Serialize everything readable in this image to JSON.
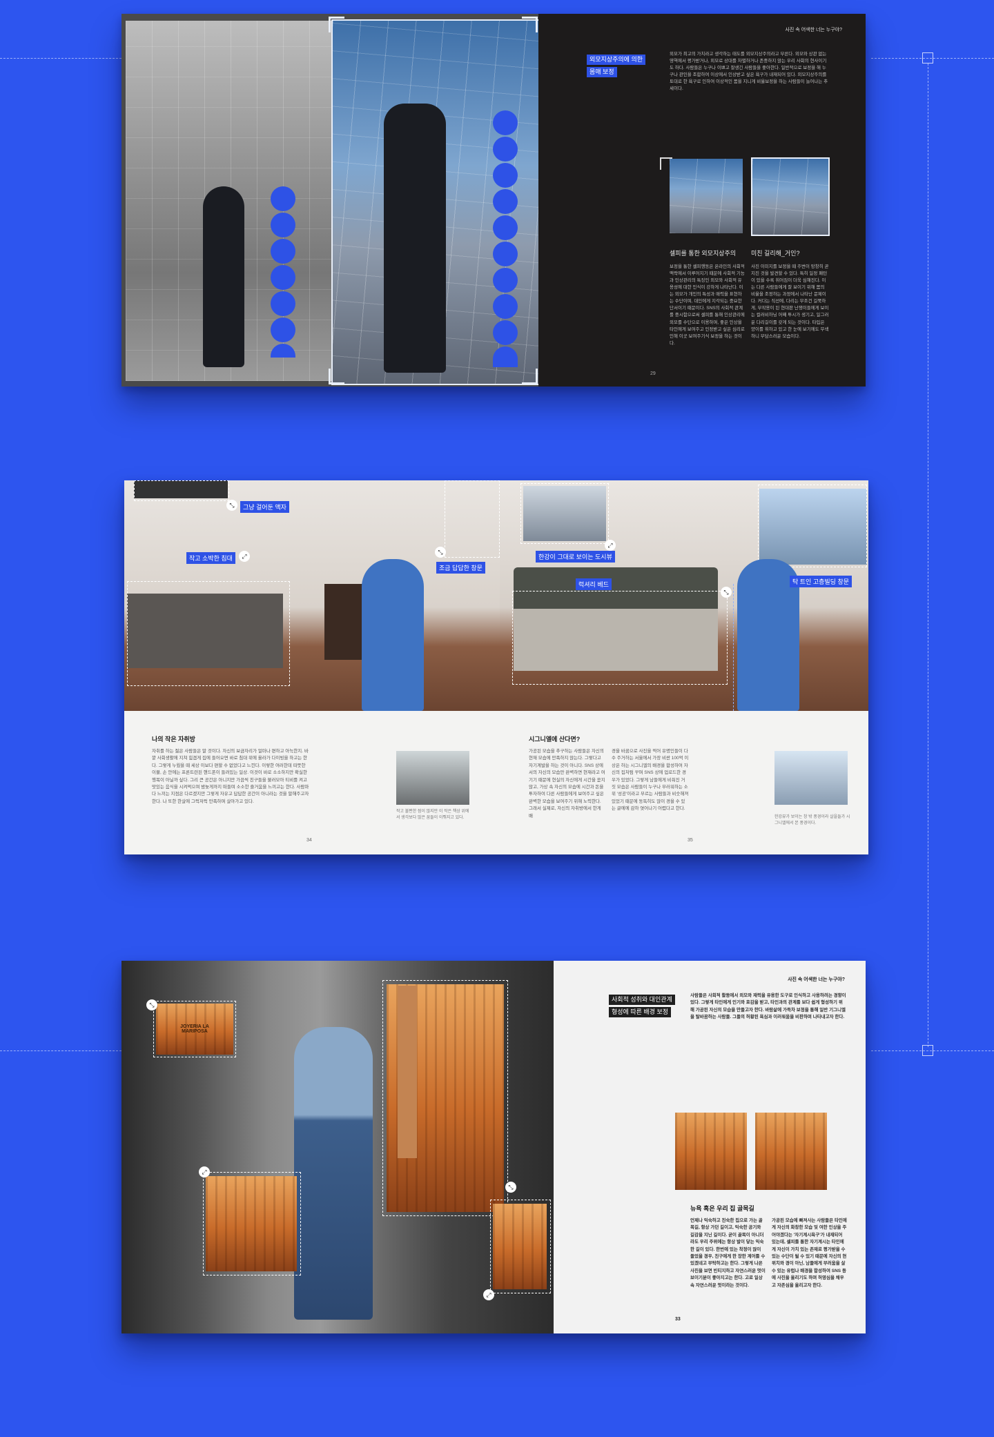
{
  "spread1": {
    "running_head": "사진 속 어색한 너는 누구야?",
    "tag": [
      "외모지상주의에 의한",
      "몸매 보정"
    ],
    "intro": "외모가 최고의 가치라고 생각하는 태도를 외모지상주의라고 부른다. 외모와 상관 없는 영역에서 평가받거나, 외모로 상대를 차별하거나 존중하지 않는 우리 사회의 현사이기도 하다. 사람들은 누구나 이쁘고 잘생긴 사람들을 좋아한다. 일반적으로 보정을 해 누구나 관인을 조합하여 이상에서 인상받고 싶은 욕구가 내재되어 있다. 외모지상주의를 토대로 한 욕구로 인하여 이상적인 몸을 지니게 비율보정을 하는 사람들이 늘어나는 추세이다.",
    "col1_head": "셀피를 통한 외모지상주의",
    "col1_body": "보정을 통한 셀피행동은 온라인의 사회적 맥락에서 이루어지기 때문에 사회적 기능과 인상관리의 특징인 외모와 사회적 유용성에 대한 인식이 강하게 나타난다. 이는 외모가 개인의 특성과 매력을 표현하는 수단이며, 대인에게 지각되는 중요한 단서이기 때문이다. SNS의 사회적 관계를 중시함으로써 셀피를 통해 인상관리에 외모를 수단으로 이용하며, 좋은 인상을 타인에게 보여주고 인정받고 싶은 심리로 인해 이곳 보여주기식 보정을 하는 것이다.",
    "col2_head": "미친 길리해_거인?",
    "col2_body": "사진 이미지를 보정을 때 주변이 망창히 곧지진 것을 발견할 수 있다. 특히 일정 패턴이 있을 수록 휘어짐이 더욱 심해진다. 이는 다른 사람들에게 잘 보이기 위해 몸의 비율을 조정하는 과정에서 나타난 문제이다. 커다는 직선에, 다리는 무조건 길쭉하게, 부작용이 된 현대판 난쟁이들에게 보이는 컬러비하닝 어째 투시가 생기고, 일그러운 다리길이를 갖게 되는 것이다. 타입은 양이를 휘하고 있고 한 눈에 보기에도 무색하니 부담스러운 모습이다.",
    "page_number": "29"
  },
  "spread2": {
    "callouts": {
      "frame": "그냥 걸어둔 액자",
      "bed_small": "작고 소박한 침대",
      "window_small": "조금 답답한 창문",
      "city_photo": "한강이 그대로 보이는 도시뷰",
      "bed_luxury": "럭셔리 베드",
      "window_wide": "탁 트인 고층빌딩 창문"
    },
    "left_head": "나의 작은 자취방",
    "left_body": "자취를 하는 젊은 사람들은 말 것이다. 자신의 보금자리가 얼마나 편하고 아늑한지. 바깥 사회생활에 지쳐 힘겹게 집에 들어오면 바로 침대 위에 올라가 다이빙을 하고는 한다. 그렇게 누웠을 때 세상 이보다 편할 수 없었다고 느낀다. 이렇한 여러한데 따뜻한 이불, 손 안에는 프론트련된 핸드폰이 들려있는 일상. 이것이 바로 소소하지만 확실한 행복이 아닐까 싶다. 그리 큰 공간은 아니지만 가끔씩 친구들을 불러모아 티비를 켜고 맛있는 음식을 시켜먹으며 밤늦게까지 떠들며 소소한 즐거움을 느끼고는 한다. 사람마다 느끼는 지점은 다르겠지만 그렇게 자유고 답답한 공간이 아니라는 것을 말해주고자 한다. 나 또한 한살에 그럭저럭 만족하며 살아가고 있다.",
    "left_caption": "작고 불편한 점이 많지만 이 작은 책상 위에서 생각보다 많은 꿈들이 이뤄지고 있다.",
    "left_page": "34",
    "right_head": "시그니엘에 산다면?",
    "right_body_1": "가공된 모습을 추구하는 사람들은 자신의 현재 모습에 만족하지 않는다. 그렇다고 자기계발을 하는 것이 아니다. SNS 상에서의 자신의 모습만 완벽하면 현재라고 여기기 때문에 현실의 자신에게 시간을 쏟지 않고, 가상 속 자신의 모습에 시간과 돈을 투자하여 다른 사람들에게 보여주고 싶은 완벽한 모습을 보여주기 위해 노력한다. 그래서 실제로, 자신의 자취방에서 한게 배",
    "right_body_2": "경을 바꿈으로 사진을 찍어 유명인들이 다수 주거하는 서울에서 가장 비싼 100억 이상은 하는 시그니엘의 배경을 합성하여 자신의 집처럼 꾸며 SNS 상에 업로드한 경우가 있었다. 그렇게 남들에게 비춰진 거짓 모습은 사람들이 누구나 부러워하는 소위 '성공'이라고 부르는 사람들과 비슷해져 있었기 때문에 동독히도 많이 경을 수 있는 글에에 감하 엿어나기 어렵다고 한다.",
    "right_caption": "한강뷰가 보이는 창 밖 풍경이라 살을들가 시그니엘에서 본 풍경이다.",
    "right_page": "35"
  },
  "spread3": {
    "running_head": "사진 속 어색한 너는 누구야?",
    "tag": [
      "사회적 성취와 대인관계",
      "형성에 따른 배경 보정"
    ],
    "intro": "사람들은 사회적 활동에서 외모와 재력을 유용한 도구로 인식하고 사용하려는 경향이 있다. 그렇게 타인에게 인기와 호감을 받고, 타인과의 관계를 보다 쉽게 형성하기 위해 가공된 자신의 모습을 만들고자 한다. 바람삶에 가득차 보정을 통해 일반 기그니엘을 탈바꿈하는 사람들. 그들의 허황된 욕심과 이러워움을 비판하며 나타내고자 한다.",
    "sign_text": "JOYERIA LA MARIPOSA",
    "section_head": "뉴욕 혹은 우리 집 골목길",
    "col1": "언제나 익숙하고 친숙한 집으로 가는 골목길, 항상 가던 길이고, 익숙한 공기와 길감을 지닌 길이다. 굳이 골목이 아니더라도 우리 주위에는 항상 발이 닿는 익숙한 길이 있다. 한번에 있는 착정이 많이 들었을 경우, 친구에게 한 장한 계어를 수 있겠네고 부탁하고는 한다. 그렇게 나온 사진을 보면 빈티지하고 자연스러운 멋이 보이기분이 좋아지고는 한다. 고로 일상속 자연스러운 멋이라는 것이다.",
    "col2": "가공된 모습에 빠져사는 사람들은 타인에게 자신의 화창한 모습 및 여한 인상을 주어야겠다는 '자기계시욕구'가 내재되어 있는데, 셀피를 통한 자기계시는 타인에게 자신이 가치 있는 존재로 평가받을 수 있는 수단이 될 수 있기 때문에 자신의 현 위치와 경이 아닌, 남들에게 부러움을 살 수 있는 유럽나 배경을 합성하여 SNS 등에 사진을 올리기도 하며 허영심을 채우고 자존심을 올리고자 한다.",
    "page_number": "33"
  },
  "colors": {
    "background": "#2d55ef",
    "accent": "#2e52e6",
    "dark_page": "#1d1b1b",
    "light_page": "#f3f3f2"
  },
  "icons": [
    "resize-arrow-icon"
  ]
}
